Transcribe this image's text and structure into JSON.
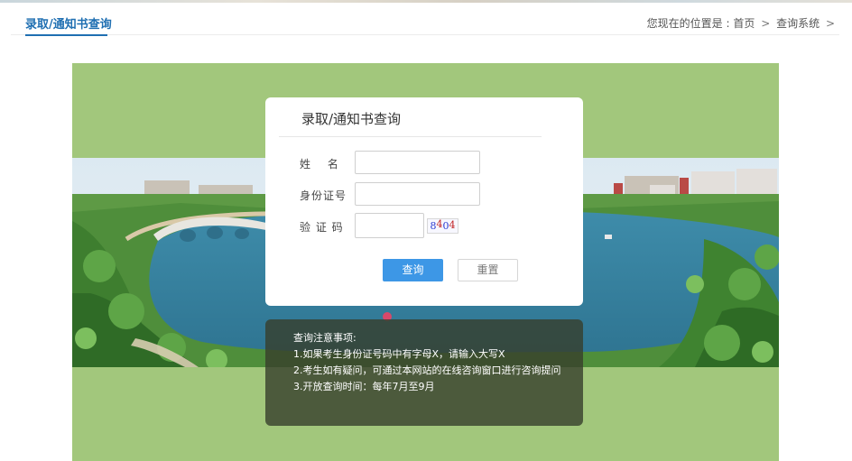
{
  "header": {
    "title": "录取/通知书查询",
    "breadcrumb_prefix": "您现在的位置是 :",
    "breadcrumb_items": [
      "首页",
      "查询系统"
    ],
    "breadcrumb_sep": ">"
  },
  "form": {
    "title": "录取/通知书查询",
    "name_label": "姓　 名",
    "id_label": "身份证号",
    "captcha_label": "验 证 码",
    "name_value": "",
    "id_value": "",
    "captcha_value": "",
    "captcha_text": [
      "8",
      "4",
      "0",
      "4"
    ],
    "captcha_colors": [
      "#2b3bd1",
      "#c22121",
      "#2b3bd1",
      "#c22121"
    ],
    "query_button": "查询",
    "reset_button": "重置"
  },
  "notice": {
    "heading": "查询注意事项:",
    "lines": [
      "1.如果考生身份证号码中有字母X，请输入大写X",
      "2.考生如有疑问，可通过本网站的在线咨询窗口进行咨询提问",
      "3.开放查询时间：每年7月至9月"
    ]
  },
  "colors": {
    "accent": "#1f6fb2",
    "button_primary": "#3d97e6",
    "stage_green": "#a2c77c"
  }
}
